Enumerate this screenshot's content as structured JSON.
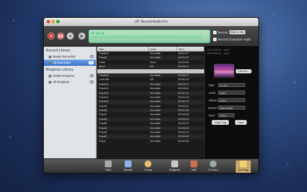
{
  "window": {
    "title": "UIT Record Audio Pro"
  },
  "toolbar": {
    "record_icon": "record-icon",
    "pause_icon": "pause-icon",
    "stop_icon": "stop-icon",
    "play_icon": "play-icon",
    "wave_lcd": "00:00:00",
    "record_label": "Record",
    "source_value": "Built-in Mic",
    "record_computer_label": "Record Computer Audio"
  },
  "sidebar": {
    "record_library_title": "Record Library",
    "record_items": [
      {
        "label": "Newly Recorded",
        "count": "0"
      },
      {
        "label": "All Recorded",
        "count": "72"
      }
    ],
    "ringtone_library_title": "Ringtone Library",
    "ringtone_items": [
      {
        "label": "Newly Ringtone",
        "count": "0"
      },
      {
        "label": "All Ringtone",
        "count": "0"
      }
    ]
  },
  "list": {
    "headers": [
      "Title",
      "Artist",
      "Time"
    ],
    "rows": [
      [
        "Track15",
        "No Artist",
        "00:01:27"
      ],
      [
        "Track1",
        "No Artist",
        "00:01:22"
      ],
      [
        "Coint",
        "Jenu",
        "00:00:09"
      ],
      [
        "Ment",
        "Kit",
        "00:05:11"
      ],
      [
        "",
        "",
        ""
      ],
      [
        "Track16",
        "No Artist",
        "00:00:27"
      ],
      [
        "Love Me",
        "Kit",
        "00:00:13"
      ],
      [
        "Track14",
        "No Artist",
        "00:00:27"
      ],
      [
        "Track13",
        "No Artist",
        "00:04:50"
      ],
      [
        "Track12",
        "No Artist",
        "00:01:31"
      ],
      [
        "Track11",
        "No Artist",
        "00:02:15"
      ],
      [
        "Track10",
        "No Artist",
        "00:00:12"
      ],
      [
        "Track9",
        "No Artist",
        "00:00:21"
      ],
      [
        "Track8",
        "No Artist",
        "00:01:40"
      ],
      [
        "Track7",
        "No Artist",
        "00:00:08"
      ],
      [
        "Track6",
        "No Artist",
        "00:00:20"
      ],
      [
        "Track5",
        "No Artist",
        "00:00:22"
      ],
      [
        "Track4",
        "No Artist",
        "00:00:21"
      ],
      [
        "Track3",
        "No Artist",
        "00:00:19"
      ],
      [
        "Track2",
        "No Artist",
        "00:00:05"
      ],
      [
        "Track",
        "No Artist",
        "00:02:35"
      ]
    ],
    "selected_row": 4
  },
  "tag_panel": {
    "info_lines": [
      "2013-08-15 ...mp3",
      "2013-08-15 ...mp3"
    ],
    "choose_label": "Choose...",
    "fields": [
      {
        "label": "Title:",
        "value": "I Love"
      },
      {
        "label": "Artist:",
        "value": "point"
      },
      {
        "label": "Album:",
        "value": "point"
      },
      {
        "label": "Genre:",
        "value": "Alternative"
      },
      {
        "label": "Year:",
        "value": "2013"
      }
    ],
    "clear_label": "Clear Tag",
    "save_label": "Save"
  },
  "bottom": {
    "buttons": [
      {
        "label": "Filter",
        "icon": "filter-icon"
      },
      {
        "label": "Reveal",
        "icon": "folder-icon"
      },
      {
        "label": "iTunes",
        "icon": "itunes-icon"
      },
      {
        "label": "Ringtone",
        "icon": "bell-icon"
      },
      {
        "label": "Edit",
        "icon": "scissors-icon"
      },
      {
        "label": "CD Burn",
        "icon": "disc-icon"
      },
      {
        "label": "Edit Tag",
        "icon": "tag-icon"
      }
    ],
    "active_index": 6
  }
}
